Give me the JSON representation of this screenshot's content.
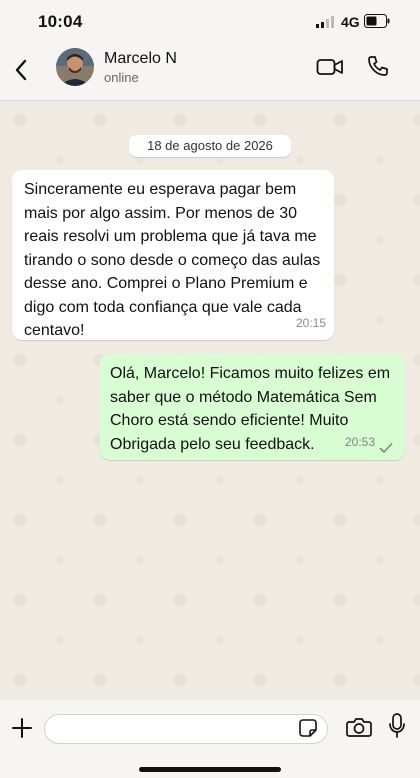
{
  "status_bar": {
    "time": "10:04",
    "network": "4G"
  },
  "header": {
    "contact_name": "Marcelo N",
    "contact_status": "online"
  },
  "chat": {
    "date_chip": "18 de agosto de 2026",
    "messages": [
      {
        "direction": "incoming",
        "text": "Sinceramente eu esperava pagar bem mais por algo assim. Por menos de 30 reais resolvi um problema que já tava me tirando o sono desde o começo das aulas desse ano. Comprei o Plano Premium e digo com toda confiança que vale cada centavo!",
        "time": "20:15"
      },
      {
        "direction": "outgoing",
        "text": "Olá, Marcelo! Ficamos muito felizes em saber que o método Matemática Sem Choro está sendo eficiente! Muito Obrigada pelo seu feedback.",
        "time": "20:53",
        "status_icon": "single-check-icon"
      }
    ]
  },
  "composer": {
    "input_value": "",
    "input_placeholder": ""
  },
  "icons": {
    "back": "chevron-left-icon",
    "video": "video-camera-icon",
    "call": "phone-icon",
    "attach": "plus-icon",
    "sticker": "sticker-icon",
    "camera": "camera-icon",
    "mic": "microphone-icon"
  },
  "colors": {
    "chat_background": "#efeae2",
    "incoming_bubble": "#ffffff",
    "outgoing_bubble": "#d9fdd3",
    "header_background": "#f6f5f3"
  }
}
